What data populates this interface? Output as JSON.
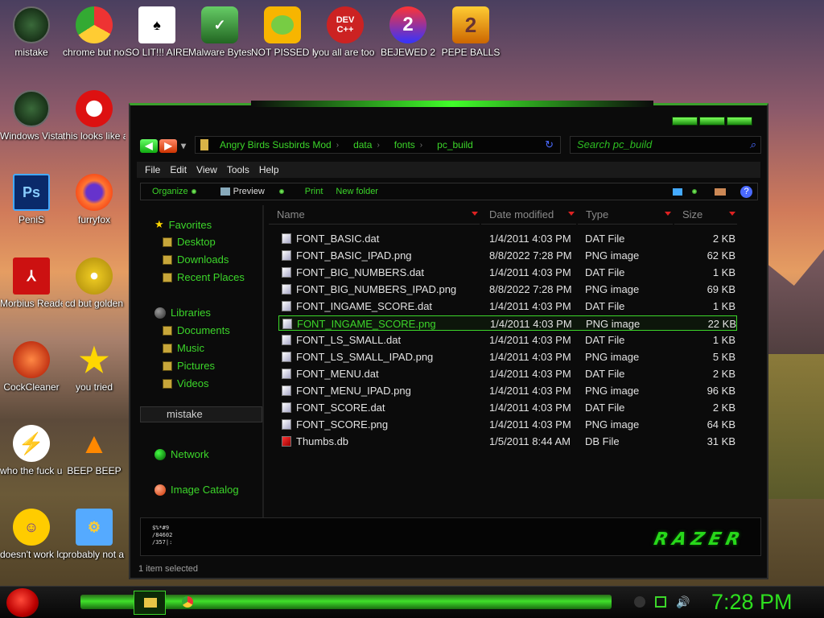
{
  "desktop": {
    "icons": [
      {
        "label": "mistake"
      },
      {
        "label": "chrome but normal c..."
      },
      {
        "label": "SO LIT!!! AIRE"
      },
      {
        "label": "Malware Bytes"
      },
      {
        "label": "NOT PISSED B..."
      },
      {
        "label": "you all are too stupid..."
      },
      {
        "label": "BEJEWED 2"
      },
      {
        "label": "PEPE BALLS"
      },
      {
        "label": "Windows Vista"
      },
      {
        "label": "this looks like a vagi..."
      },
      {
        "label": "PeniS"
      },
      {
        "label": "furryfox"
      },
      {
        "label": "Morbius Reader"
      },
      {
        "label": "cd but golden"
      },
      {
        "label": "CockCleaner"
      },
      {
        "label": "you tried"
      },
      {
        "label": "who the fuck uses this"
      },
      {
        "label": "BEEP BEEP"
      },
      {
        "label": "doesn't work lol"
      },
      {
        "label": "probably not a rogue"
      }
    ],
    "icon_glyphs": {
      "devcpp": "DEV C++",
      "bejeweled": "2",
      "pepe": "2",
      "photoshop": "Ps"
    }
  },
  "explorer": {
    "breadcrumb": [
      "Angry Birds Susbirds Mod",
      "data",
      "fonts",
      "pc_build"
    ],
    "search_placeholder": "Search pc_build",
    "menu": [
      "File",
      "Edit",
      "View",
      "Tools",
      "Help"
    ],
    "commands": {
      "organize": "Organize",
      "preview": "Preview",
      "print": "Print",
      "new_folder": "New folder"
    },
    "nav": {
      "favorites": "Favorites",
      "desktop": "Desktop",
      "downloads": "Downloads",
      "recent": "Recent Places",
      "libraries": "Libraries",
      "documents": "Documents",
      "music": "Music",
      "pictures": "Pictures",
      "videos": "Videos",
      "user": "mistake",
      "network": "Network",
      "catalog": "Image Catalog"
    },
    "columns": {
      "name": "Name",
      "date": "Date modified",
      "type": "Type",
      "size": "Size"
    },
    "files": [
      {
        "name": "FONT_BASIC.dat",
        "date": "1/4/2011 4:03 PM",
        "type": "DAT File",
        "size": "2 KB"
      },
      {
        "name": "FONT_BASIC_IPAD.png",
        "date": "8/8/2022 7:28 PM",
        "type": "PNG image",
        "size": "62 KB"
      },
      {
        "name": "FONT_BIG_NUMBERS.dat",
        "date": "1/4/2011 4:03 PM",
        "type": "DAT File",
        "size": "1 KB"
      },
      {
        "name": "FONT_BIG_NUMBERS_IPAD.png",
        "date": "8/8/2022 7:28 PM",
        "type": "PNG image",
        "size": "69 KB"
      },
      {
        "name": "FONT_INGAME_SCORE.dat",
        "date": "1/4/2011 4:03 PM",
        "type": "DAT File",
        "size": "1 KB"
      },
      {
        "name": "FONT_INGAME_SCORE.png",
        "date": "1/4/2011 4:03 PM",
        "type": "PNG image",
        "size": "22 KB",
        "selected": true
      },
      {
        "name": "FONT_LS_SMALL.dat",
        "date": "1/4/2011 4:03 PM",
        "type": "DAT File",
        "size": "1 KB"
      },
      {
        "name": "FONT_LS_SMALL_IPAD.png",
        "date": "1/4/2011 4:03 PM",
        "type": "PNG image",
        "size": "5 KB"
      },
      {
        "name": "FONT_MENU.dat",
        "date": "1/4/2011 4:03 PM",
        "type": "DAT File",
        "size": "2 KB"
      },
      {
        "name": "FONT_MENU_IPAD.png",
        "date": "1/4/2011 4:03 PM",
        "type": "PNG image",
        "size": "96 KB"
      },
      {
        "name": "FONT_SCORE.dat",
        "date": "1/4/2011 4:03 PM",
        "type": "DAT File",
        "size": "2 KB"
      },
      {
        "name": "FONT_SCORE.png",
        "date": "1/4/2011 4:03 PM",
        "type": "PNG image",
        "size": "64 KB"
      },
      {
        "name": "Thumbs.db",
        "date": "1/5/2011 8:44 AM",
        "type": "DB File",
        "size": "31 KB"
      }
    ],
    "preview_glyphs": [
      "$%*#9",
      "/84602",
      "/357|:"
    ],
    "brand": "RAZER",
    "status": "1 item selected"
  },
  "taskbar": {
    "clock": "7:28 PM"
  },
  "colors": {
    "accent": "#3cd62a",
    "window_bg": "#0b0b0b",
    "text": "#e2e2e2"
  }
}
